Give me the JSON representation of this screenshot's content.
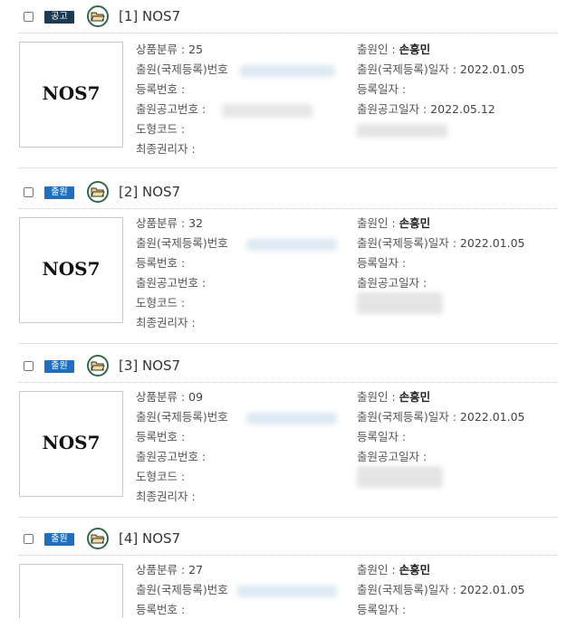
{
  "colors": {
    "badge_announce": "#1d3a55",
    "badge_filed": "#1e6fc0",
    "folder_ring": "#2f6b46"
  },
  "labels": {
    "class": "상품분류 : ",
    "app_no": "출원(국제등록)번호",
    "reg_no": "등록번호 :",
    "pub_no": "출원공고번호 :",
    "design_code": "도형코드 :",
    "final_holder": "최종권리자 :",
    "applicant": "출원인 : ",
    "app_date": "출원(국제등록)일자 : ",
    "reg_date": "등록일자 :",
    "pub_date": "출원공고일자 : "
  },
  "results": [
    {
      "badge": "공고",
      "badge_color": "#1d3a55",
      "title": "[1] NOS7",
      "image_text": "NOS7",
      "class_value": "25",
      "applicant": "손흥민",
      "app_date": "2022.01.05",
      "pub_date": "2022.05.12"
    },
    {
      "badge": "출원",
      "badge_color": "#1e6fc0",
      "title": "[2] NOS7",
      "image_text": "NOS7",
      "class_value": "32",
      "applicant": "손흥민",
      "app_date": "2022.01.05",
      "pub_date": ""
    },
    {
      "badge": "출원",
      "badge_color": "#1e6fc0",
      "title": "[3] NOS7",
      "image_text": "NOS7",
      "class_value": "09",
      "applicant": "손흥민",
      "app_date": "2022.01.05",
      "pub_date": ""
    },
    {
      "badge": "출원",
      "badge_color": "#1e6fc0",
      "title": "[4] NOS7",
      "image_text": "",
      "class_value": "27",
      "applicant": "손흥민",
      "app_date": "2022.01.05",
      "pub_date": ""
    }
  ]
}
